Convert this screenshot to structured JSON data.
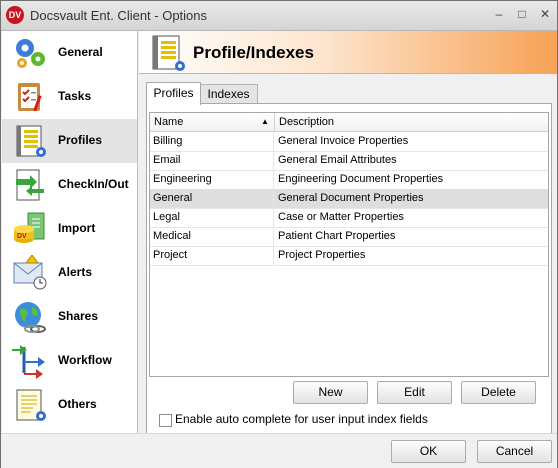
{
  "window": {
    "title": "Docsvault Ent. Client - Options",
    "app_icon_text": "DV",
    "minimize": "–",
    "maximize": "□",
    "close": "✕"
  },
  "sidebar": {
    "items": [
      {
        "label": "General",
        "icon": "gears-icon"
      },
      {
        "label": "Tasks",
        "icon": "clipboard-checklist-icon"
      },
      {
        "label": "Profiles",
        "icon": "profile-document-icon",
        "selected": true
      },
      {
        "label": "CheckIn/Out",
        "icon": "checkin-checkout-icon"
      },
      {
        "label": "Import",
        "icon": "import-icon"
      },
      {
        "label": "Alerts",
        "icon": "alert-envelope-icon"
      },
      {
        "label": "Shares",
        "icon": "globe-share-icon"
      },
      {
        "label": "Workflow",
        "icon": "workflow-arrows-icon"
      },
      {
        "label": "Others",
        "icon": "document-gear-icon"
      }
    ]
  },
  "header": {
    "title": "Profile/Indexes",
    "icon": "profile-document-icon"
  },
  "tabs": [
    {
      "label": "Profiles",
      "active": true
    },
    {
      "label": "Indexes",
      "active": false
    }
  ],
  "grid": {
    "columns": [
      "Name",
      "Description"
    ],
    "sort_column": "Name",
    "sort_direction": "ascending",
    "rows": [
      {
        "name": "Billing",
        "description": "General Invoice Properties"
      },
      {
        "name": "Email",
        "description": "General Email Attributes"
      },
      {
        "name": "Engineering",
        "description": "Engineering Document Properties"
      },
      {
        "name": "General",
        "description": "General Document Properties",
        "selected": true
      },
      {
        "name": "Legal",
        "description": "Case or Matter Properties"
      },
      {
        "name": "Medical",
        "description": "Patient Chart Properties"
      },
      {
        "name": "Project",
        "description": "Project Properties"
      }
    ]
  },
  "buttons": {
    "new": "New",
    "edit": "Edit",
    "delete": "Delete"
  },
  "autocomplete": {
    "label": "Enable auto complete for user input index fields",
    "checked": false
  },
  "footer": {
    "ok": "OK",
    "cancel": "Cancel"
  },
  "colors": {
    "header_gradient_end": "#f7a155",
    "selected_row": "#dedede",
    "app_icon": "#c8161d"
  }
}
